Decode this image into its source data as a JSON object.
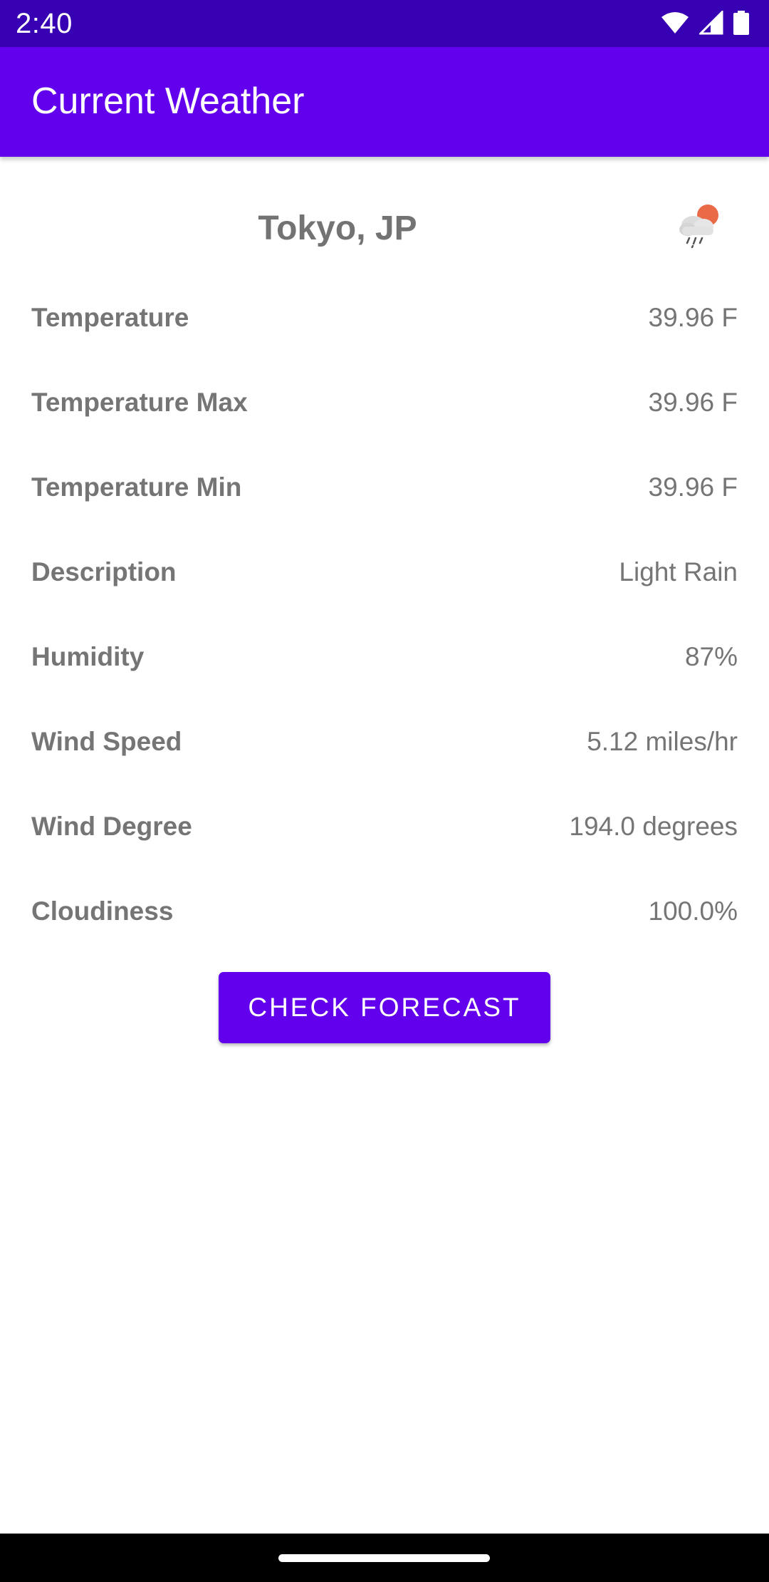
{
  "status_bar": {
    "time": "2:40",
    "icons": [
      "wifi-icon",
      "cellular-signal-icon",
      "battery-icon"
    ]
  },
  "app_bar": {
    "title": "Current Weather",
    "color": "#6200ee"
  },
  "location": {
    "city": "Tokyo, JP",
    "weather_icon": "light-rain-cloud-sun-icon"
  },
  "details": [
    {
      "label": "Temperature",
      "value": "39.96 F"
    },
    {
      "label": "Temperature Max",
      "value": "39.96 F"
    },
    {
      "label": "Temperature Min",
      "value": "39.96 F"
    },
    {
      "label": "Description",
      "value": "Light Rain"
    },
    {
      "label": "Humidity",
      "value": "87%"
    },
    {
      "label": "Wind Speed",
      "value": "5.12 miles/hr"
    },
    {
      "label": "Wind Degree",
      "value": "194.0 degrees"
    },
    {
      "label": "Cloudiness",
      "value": "100.0%"
    }
  ],
  "actions": {
    "check_forecast_label": "CHECK FORECAST"
  },
  "colors": {
    "status_bar": "#3700b3",
    "primary": "#6200ee",
    "text": "#757575"
  }
}
